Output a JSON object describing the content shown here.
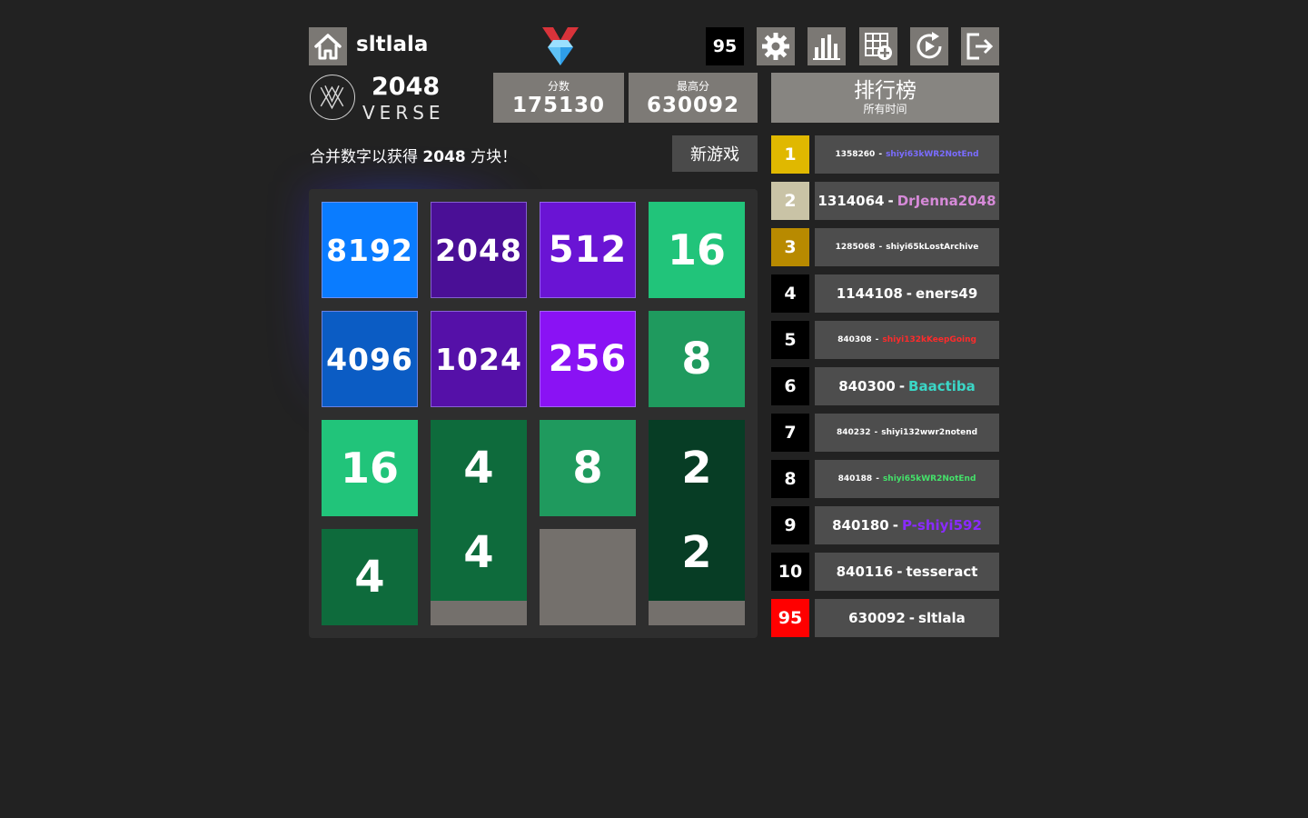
{
  "header": {
    "username": "sltlala",
    "rank_badge": "95",
    "icons": [
      "home-icon",
      "medal-diamond-icon",
      "settings-icon",
      "stats-icon",
      "add-grid-icon",
      "replay-icon",
      "logout-icon"
    ]
  },
  "logo": {
    "title": "2048",
    "subtitle": "VERSE"
  },
  "scores": {
    "score_label": "分数",
    "score_value": "175130",
    "best_label": "最高分",
    "best_value": "630092"
  },
  "leaderboard_header": {
    "title": "排行榜",
    "subtitle": "所有时间"
  },
  "intro": {
    "prefix": "合并数字以获得 ",
    "bold": "2048",
    "suffix": " 方块！"
  },
  "new_game_label": "新游戏",
  "board": {
    "tiles": [
      {
        "row": 0,
        "col": 0,
        "value": "8192",
        "color": "#0a7cff"
      },
      {
        "row": 0,
        "col": 1,
        "value": "2048",
        "color": "#4a0f96"
      },
      {
        "row": 0,
        "col": 2,
        "value": "512",
        "color": "#6a14d4"
      },
      {
        "row": 0,
        "col": 3,
        "value": "16",
        "color": "#21c47a"
      },
      {
        "row": 1,
        "col": 0,
        "value": "4096",
        "color": "#0b5cc4"
      },
      {
        "row": 1,
        "col": 1,
        "value": "1024",
        "color": "#5510a8"
      },
      {
        "row": 1,
        "col": 2,
        "value": "256",
        "color": "#8a12f4"
      },
      {
        "row": 1,
        "col": 3,
        "value": "8",
        "color": "#1f9a5e"
      },
      {
        "row": 2,
        "col": 0,
        "value": "16",
        "color": "#21c47a"
      },
      {
        "row": 2,
        "col": 1,
        "value": "4",
        "color": "#0e6b3c"
      },
      {
        "row": 2,
        "col": 2,
        "value": "8",
        "color": "#1f9a5e"
      },
      {
        "row": 2,
        "col": 3,
        "value": "2",
        "color": "#073d25"
      },
      {
        "row": 3,
        "col": 0,
        "value": "4",
        "color": "#0e6b3c"
      },
      {
        "row": 3,
        "col": 1,
        "value": "4",
        "color": "#0e6b3c"
      },
      {
        "row": 3,
        "col": 3,
        "value": "2",
        "color": "#073d25"
      }
    ]
  },
  "leaderboard": [
    {
      "rank": "1",
      "score": "1358260",
      "name": "shiyi63kWR2NotEnd",
      "rank_color": "#e0b800",
      "name_color": "#7a6cff"
    },
    {
      "rank": "2",
      "score": "1314064",
      "name": "DrJenna2048",
      "rank_color": "#c9c3a6",
      "name_color": "#d68ad8"
    },
    {
      "rank": "3",
      "score": "1285068",
      "name": "shiyi65kLostArchive",
      "rank_color": "#b88a00",
      "name_color": "#ffffff"
    },
    {
      "rank": "4",
      "score": "1144108",
      "name": "eners49",
      "rank_color": "#000000",
      "name_color": "#ffffff"
    },
    {
      "rank": "5",
      "score": "840308",
      "name": "shiyi132kKeepGoing",
      "rank_color": "#000000",
      "name_color": "#ff2b2b"
    },
    {
      "rank": "6",
      "score": "840300",
      "name": "Baactiba",
      "rank_color": "#000000",
      "name_color": "#3bd6c6"
    },
    {
      "rank": "7",
      "score": "840232",
      "name": "shiyi132wwr2notend",
      "rank_color": "#000000",
      "name_color": "#ffffff"
    },
    {
      "rank": "8",
      "score": "840188",
      "name": "shiyi65kWR2NotEnd",
      "rank_color": "#000000",
      "name_color": "#44e26a"
    },
    {
      "rank": "9",
      "score": "840180",
      "name": "P-shiyi592",
      "rank_color": "#000000",
      "name_color": "#8a2bff"
    },
    {
      "rank": "10",
      "score": "840116",
      "name": "tesseract",
      "rank_color": "#000000",
      "name_color": "#ffffff"
    },
    {
      "rank": "95",
      "score": "630092",
      "name": "sltlala",
      "rank_color": "#ff0000",
      "name_color": "#ffffff"
    }
  ]
}
